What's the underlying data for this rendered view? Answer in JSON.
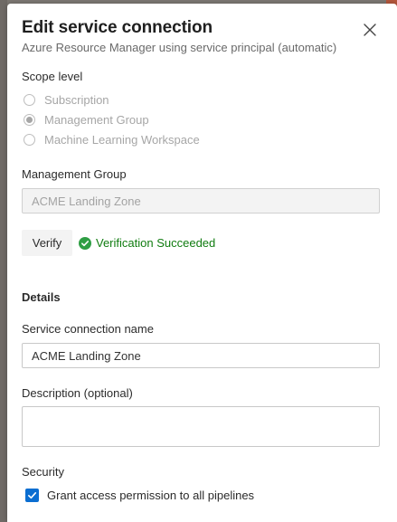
{
  "dialog": {
    "title": "Edit service connection",
    "subtitle": "Azure Resource Manager using service principal (automatic)"
  },
  "scope": {
    "label": "Scope level",
    "options": [
      {
        "label": "Subscription",
        "checked": false
      },
      {
        "label": "Management Group",
        "checked": true
      },
      {
        "label": "Machine Learning Workspace",
        "checked": false
      }
    ]
  },
  "management_group": {
    "label": "Management Group",
    "value": "ACME Landing Zone"
  },
  "verify": {
    "button_label": "Verify",
    "status_text": "Verification Succeeded",
    "status_color": "#107c10"
  },
  "details": {
    "heading": "Details",
    "connection_name_label": "Service connection name",
    "connection_name_value": "ACME Landing Zone",
    "description_label": "Description (optional)",
    "description_value": ""
  },
  "security": {
    "heading": "Security",
    "grant_access_label": "Grant access permission to all pipelines",
    "grant_access_checked": true
  },
  "colors": {
    "accent": "#0b6ed1",
    "success": "#107c10"
  }
}
